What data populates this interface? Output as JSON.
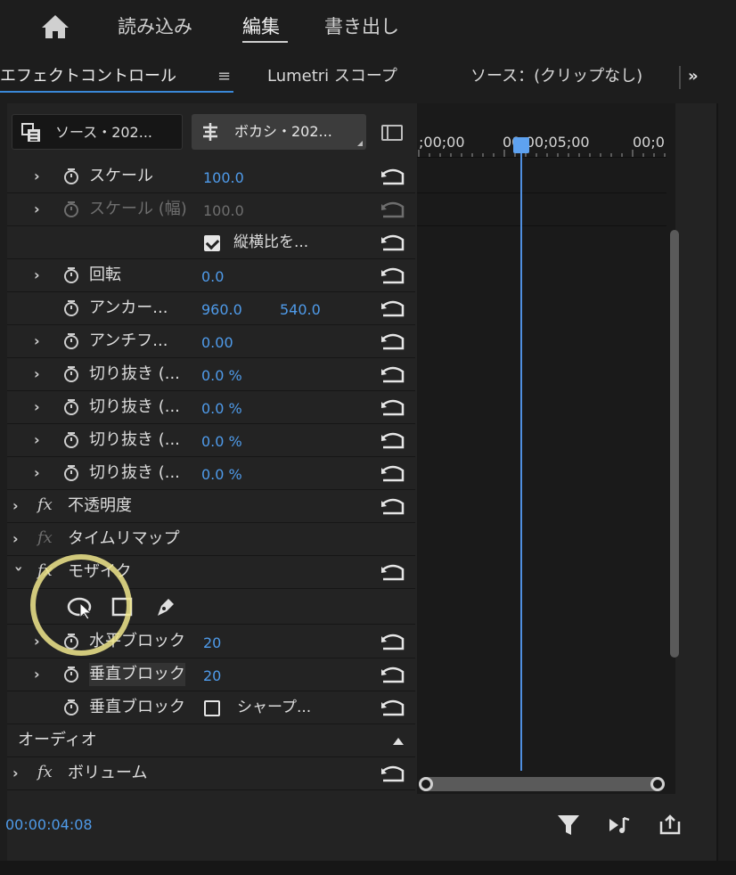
{
  "nav": {
    "items": [
      "読み込み",
      "編集",
      "書き出し"
    ],
    "active": "編集"
  },
  "tabs": {
    "effect_controls": "エフェクトコントロール",
    "menu": "≡",
    "lumetri": "Lumetri スコープ",
    "source": "ソース：(クリップなし)",
    "more": "»"
  },
  "clips": {
    "source_label": "ソース・202...",
    "effect_label": "ボカシ・202..."
  },
  "ruler": {
    "t0": ";00;00",
    "t1": "00;00;05;00",
    "t2": "00;0"
  },
  "rows": {
    "scale": {
      "name": "スケール",
      "value": "100.0"
    },
    "scale_w": {
      "name": "スケール (幅)",
      "value": "100.0"
    },
    "aspect": {
      "name": "縦横比を..."
    },
    "rotation": {
      "name": "回転",
      "value": "0.0"
    },
    "anchor": {
      "name": "アンカー...",
      "x": "960.0",
      "y": "540.0"
    },
    "antiflicker": {
      "name": "アンチフ...",
      "value": "0.00"
    },
    "crop1": {
      "name": "切り抜き (...",
      "value": "0.0 %"
    },
    "crop2": {
      "name": "切り抜き (...",
      "value": "0.0 %"
    },
    "crop3": {
      "name": "切り抜き (...",
      "value": "0.0 %"
    },
    "crop4": {
      "name": "切り抜き (...",
      "value": "0.0 %"
    },
    "opacity": {
      "name": "不透明度"
    },
    "timeremap": {
      "name": "タイムリマップ"
    },
    "mosaic": {
      "name": "モザイク"
    },
    "hblocks": {
      "name": "水平ブロック",
      "value": "20"
    },
    "vblocks": {
      "name": "垂直ブロック",
      "value": "20"
    },
    "vblocks2": {
      "name": "垂直ブロック",
      "sharp": "シャープ..."
    },
    "audio": {
      "name": "オーディオ"
    },
    "volume": {
      "name": "ボリューム"
    }
  },
  "timecode": "00:00:04:08",
  "colors": {
    "accent": "#4f9bea",
    "playhead": "#4f8fe0",
    "highlight": "#f0e68c"
  }
}
